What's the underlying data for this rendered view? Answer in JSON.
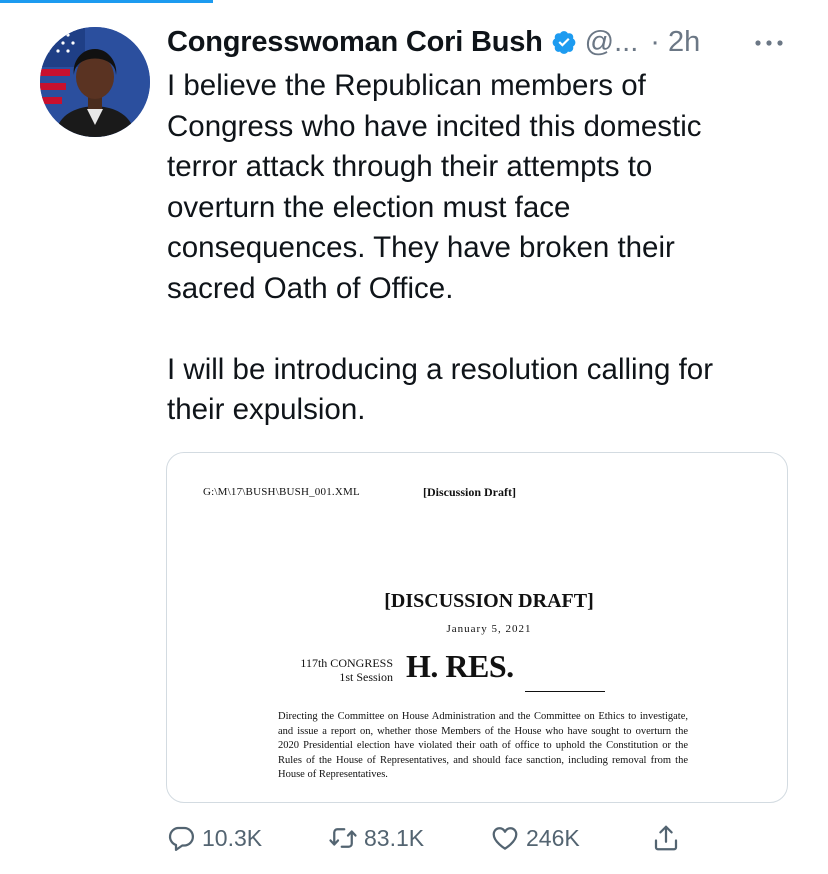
{
  "tweet": {
    "author_name": "Congresswoman Cori Bush",
    "handle": "@...",
    "time": "· 2h",
    "verified_icon": "verified-badge-icon",
    "text": "I believe the Republican members of\nCongress who have incited this domestic\nterror attack through their attempts to\noverturn the election must face\nconsequences. They have broken their\nsacred Oath of Office.\n\nI will be introducing a resolution calling for\ntheir expulsion."
  },
  "document": {
    "path": "G:\\M\\17\\BUSH\\BUSH_001.XML",
    "draft_small": "[Discussion Draft]",
    "draft_big": "[DISCUSSION DRAFT]",
    "date": "January 5, 2021",
    "congress_line1": "117th CONGRESS",
    "congress_line2": "1st Session",
    "hres": "H. RES.",
    "body": "Directing the Committee on House Administration and the Committee on Ethics to investigate, and issue a report on, whether those Members of the House who have sought to overturn the 2020 Presidential election have violated their oath of office to uphold the Constitution or the Rules of the House of Representatives, and should face sanction, including removal from the House of Representatives."
  },
  "actions": {
    "reply_count": "10.3K",
    "retweet_count": "83.1K",
    "like_count": "246K"
  },
  "colors": {
    "accent": "#1d9bf0",
    "muted": "#536471",
    "text": "#0f1419"
  }
}
